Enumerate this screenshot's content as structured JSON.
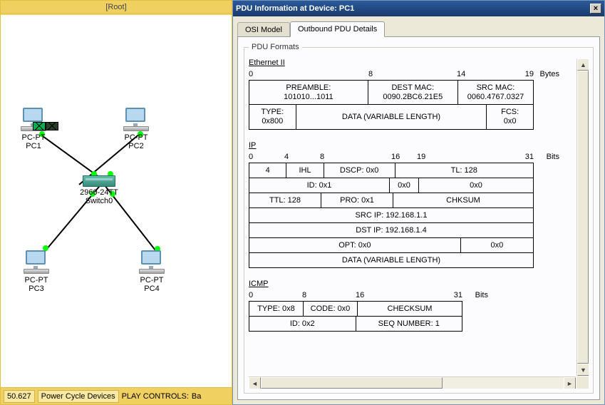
{
  "workspace": {
    "title": "[Root]",
    "footer": {
      "time": "50.627",
      "btn1": "Power Cycle Devices",
      "btn2": "PLAY CONTROLS:",
      "btn3": "Ba"
    },
    "devices": {
      "pc1": {
        "type": "PC-PT",
        "name": "PC1"
      },
      "pc2": {
        "type": "PC-PT",
        "name": "PC2"
      },
      "pc3": {
        "type": "PC-PT",
        "name": "PC3"
      },
      "pc4": {
        "type": "PC-PT",
        "name": "PC4"
      },
      "switch": {
        "type": "2960-24TT",
        "name": "Switch0"
      }
    }
  },
  "panel": {
    "title": "PDU Information at Device: PC1",
    "tab1": "OSI Model",
    "tab2": "Outbound PDU Details",
    "legend": "PDU Formats",
    "byteslabel": "Bytes",
    "bitslabel": "Bits"
  },
  "ethernet": {
    "title": "Ethernet II",
    "marks": [
      "0",
      "8",
      "14",
      "19"
    ],
    "preamble_l": "PREAMBLE:",
    "preamble_v": "101010...1011",
    "destmac_l": "DEST MAC:",
    "destmac_v": "0090.2BC6.21E5",
    "srcmac_l": "SRC MAC:",
    "srcmac_v": "0060.4767.0327",
    "type_l": "TYPE:",
    "type_v": "0x800",
    "data": "DATA (VARIABLE LENGTH)",
    "fcs_l": "FCS:",
    "fcs_v": "0x0"
  },
  "ip": {
    "title": "IP",
    "marks": [
      "0",
      "4",
      "8",
      "16",
      "19",
      "31"
    ],
    "ver": "4",
    "ihl": "IHL",
    "dscp": "DSCP: 0x0",
    "tl": "TL: 128",
    "id": "ID: 0x1",
    "flags": "0x0",
    "frag": "0x0",
    "ttl": "TTL: 128",
    "pro": "PRO: 0x1",
    "chksum": "CHKSUM",
    "srcip": "SRC IP: 192.168.1.1",
    "dstip": "DST IP: 192.168.1.4",
    "opt": "OPT: 0x0",
    "pad": "0x0",
    "data": "DATA (VARIABLE LENGTH)"
  },
  "icmp": {
    "title": "ICMP",
    "marks": [
      "0",
      "8",
      "16",
      "31"
    ],
    "type": "TYPE: 0x8",
    "code": "CODE: 0x0",
    "chksum": "CHECKSUM",
    "id": "ID: 0x2",
    "seq": "SEQ NUMBER: 1"
  }
}
